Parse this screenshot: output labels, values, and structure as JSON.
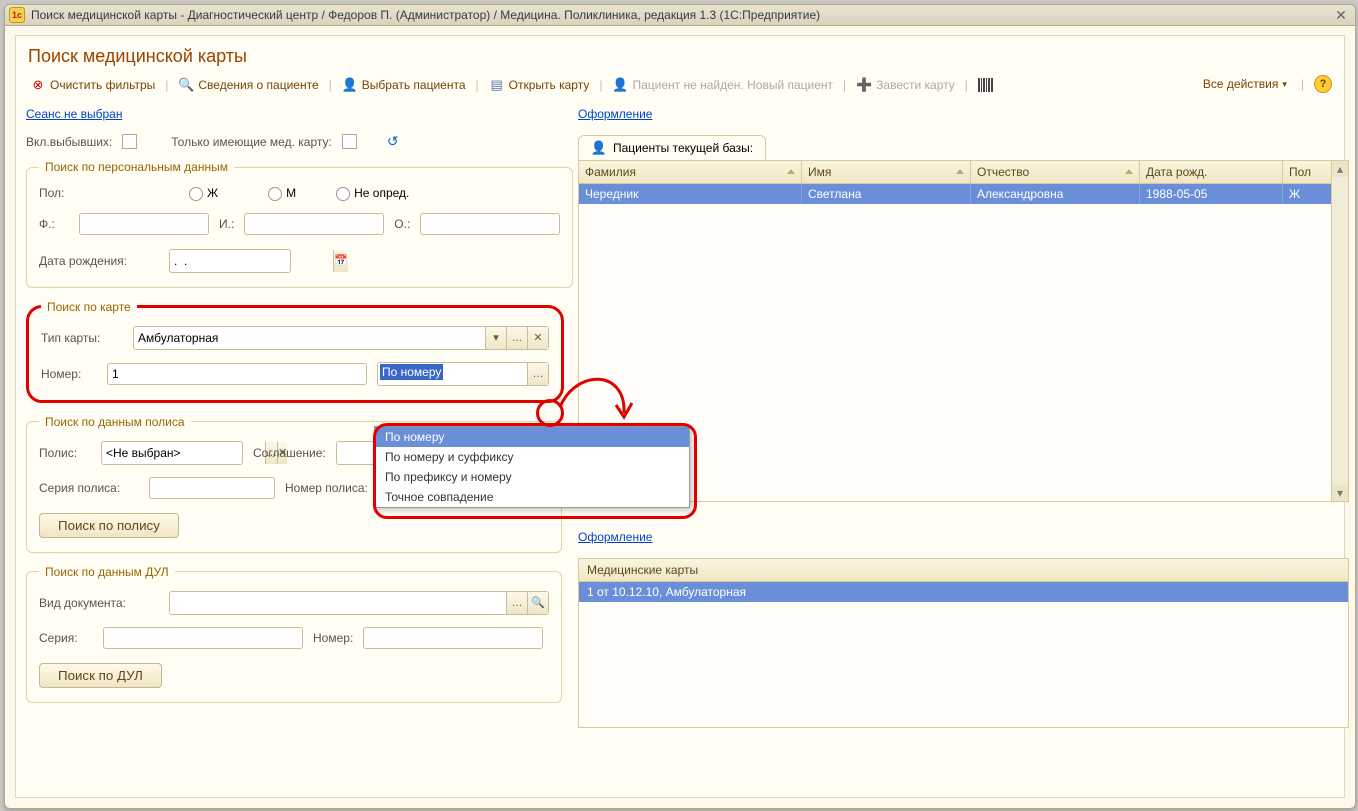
{
  "window": {
    "title": "Поиск медицинской карты - Диагностический центр / Федоров П. (Администратор) / Медицина. Поликлиника, редакция 1.3  (1С:Предприятие)"
  },
  "page": {
    "title": "Поиск медицинской карты"
  },
  "toolbar": {
    "clear": "Очистить фильтры",
    "patient_info": "Сведения о пациенте",
    "select_patient": "Выбрать пациента",
    "open_card": "Открыть карту",
    "not_found": "Пациент не найден. Новый пациент",
    "new_card": "Завести карту",
    "all_actions": "Все действия"
  },
  "left": {
    "session": "Сеанс не выбран",
    "vkl": "Вкл.выбывших:",
    "only_has": "Только имеющие мед. карту:",
    "personal": {
      "legend": "Поиск по персональным данным",
      "pol": "Пол:",
      "pol_zh": "Ж",
      "pol_m": "М",
      "pol_neop": "Не опред.",
      "f": "Ф.:",
      "i": "И.:",
      "o": "О.:",
      "dob": "Дата рождения:",
      "dob_value": ".  ."
    },
    "card": {
      "legend": "Поиск по  карте",
      "type_label": "Тип карты:",
      "type_value": "Амбулаторная",
      "num_label": "Номер:",
      "num_value": "1",
      "mode_value": "По номеру"
    },
    "policy": {
      "legend": "Поиск по данным полиса",
      "polis": "Полис:",
      "polis_value": "<Не выбран>",
      "sogl": "Соглашение:",
      "series": "Серия полиса:",
      "number": "Номер полиса:",
      "btn": "Поиск по полису"
    },
    "dul": {
      "legend": "Поиск по данным ДУЛ",
      "doc_type": "Вид документа:",
      "series": "Серия:",
      "number": "Номер:",
      "btn": "Поиск по ДУЛ"
    }
  },
  "right": {
    "oform1": "Оформление",
    "tab": "Пациенты текущей базы:",
    "cols": {
      "fam": "Фамилия",
      "imya": "Имя",
      "otch": "Отчество",
      "dr": "Дата рожд.",
      "pol": "Пол"
    },
    "row": {
      "fam": "Чередник",
      "imya": "Светлана",
      "otch": "Александровна",
      "dr": "1988-05-05",
      "pol": "Ж"
    },
    "oform2": "Оформление",
    "cards_header": "Медицинские карты",
    "card_row": "1 от 10.12.10, Амбулаторная"
  },
  "dropdown": {
    "options": [
      "По номеру",
      "По номеру и суффиксу",
      "По префиксу и номеру",
      "Точное совпадение"
    ],
    "o0": "По номеру",
    "o1": "По номеру и суффиксу",
    "o2": "По префиксу и номеру",
    "o3": "Точное совпадение"
  }
}
